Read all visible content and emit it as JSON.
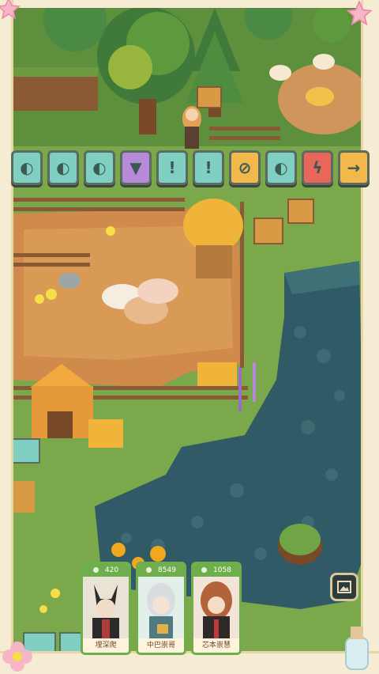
{
  "action_bar": {
    "tiles": [
      {
        "icon": "seed-icon",
        "color": "#7fd0c2"
      },
      {
        "icon": "seed-icon",
        "color": "#7fd0c2"
      },
      {
        "icon": "seed-icon",
        "color": "#7fd0c2"
      },
      {
        "icon": "carrot-icon",
        "color": "#b68ad8"
      },
      {
        "icon": "alert-icon",
        "color": "#7fd0c2"
      },
      {
        "icon": "alert-icon",
        "color": "#7fd0c2"
      },
      {
        "icon": "no-icon",
        "color": "#f2b84b"
      },
      {
        "icon": "seed-icon",
        "color": "#7fd0c2"
      },
      {
        "icon": "lightning-icon",
        "color": "#e8675a"
      },
      {
        "icon": "arrow-right-icon",
        "color": "#f2b84b"
      }
    ]
  },
  "hero_cards": [
    {
      "cost": "420",
      "name": "埋深爬"
    },
    {
      "cost": "8549",
      "name": "中巴崇哥"
    },
    {
      "cost": "1058",
      "name": "芯本崇慧"
    }
  ],
  "colors": {
    "grass": "#7aa84a",
    "dirt": "#d89a55",
    "water": "#2f5a66",
    "accent_green": "#6fae4c"
  },
  "icons": {
    "gallery": "gallery-icon",
    "corner_star": "star-icon",
    "corner_flower": "flower-icon"
  }
}
